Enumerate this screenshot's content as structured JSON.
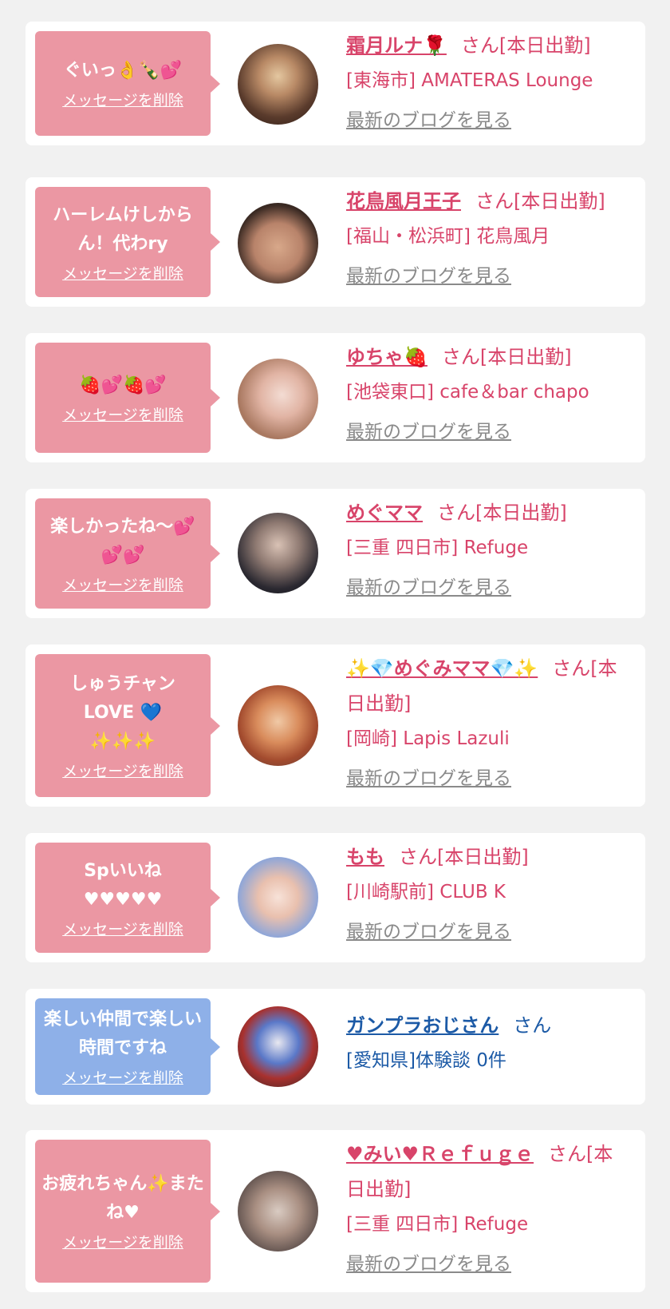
{
  "delete_label": "メッセージを削除",
  "blog_label": "最新のブログを見る",
  "colors": {
    "page_bg": "#f1f1f1",
    "card_bg": "#ffffff",
    "bubble_pink": "#eb97a3",
    "bubble_blue": "#8eb0e8",
    "text_pink": "#d8446a",
    "text_blue": "#1c5aa6",
    "link_gray": "#8a8a8a"
  },
  "cards": [
    {
      "message": "ぐいっ👌🍾💕",
      "name": "霜月ルナ🌹",
      "honorific": "さん[本日出勤]",
      "store": "[東海市] AMATERAS Lounge",
      "blog": true
    },
    {
      "message": "ハーレムけしからん！代わry",
      "name": "花鳥風月王子",
      "honorific": "さん[本日出勤]",
      "store": "[福山・松浜町] 花鳥風月",
      "blog": true
    },
    {
      "message": "🍓💕🍓💕",
      "name": "ゆちゃ🍓",
      "honorific": "さん[本日出勤]",
      "store": "[池袋東口] cafe＆bar chapo",
      "blog": true
    },
    {
      "message": "楽しかったね〜💕💕💕",
      "name": "めぐママ",
      "honorific": "さん[本日出勤]",
      "store": "[三重 四日市] Refuge",
      "blog": true
    },
    {
      "message": "しゅうチャン\nLOVE 💙\n✨✨✨",
      "name": "✨💎めぐみママ💎✨",
      "honorific": "さん[本日出勤]",
      "store": "[岡崎] Lapis Lazuli",
      "blog": true
    },
    {
      "message": "Spいいね\n♥♥♥♥♥",
      "name": "もも",
      "honorific": "さん[本日出勤]",
      "store": "[川崎駅前] CLUB K",
      "blog": true
    },
    {
      "message": "楽しい仲間で楽しい時間ですね",
      "name": "ガンプラおじさん",
      "honorific": "さん",
      "store": "[愛知県]体験談 0件",
      "blog": false
    },
    {
      "message": "お疲れちゃん✨またね♥",
      "name": "♥みい♥Ｒｅｆｕｇｅ",
      "honorific": "さん[本日出勤]",
      "store": "[三重 四日市] Refuge",
      "blog": true
    }
  ]
}
